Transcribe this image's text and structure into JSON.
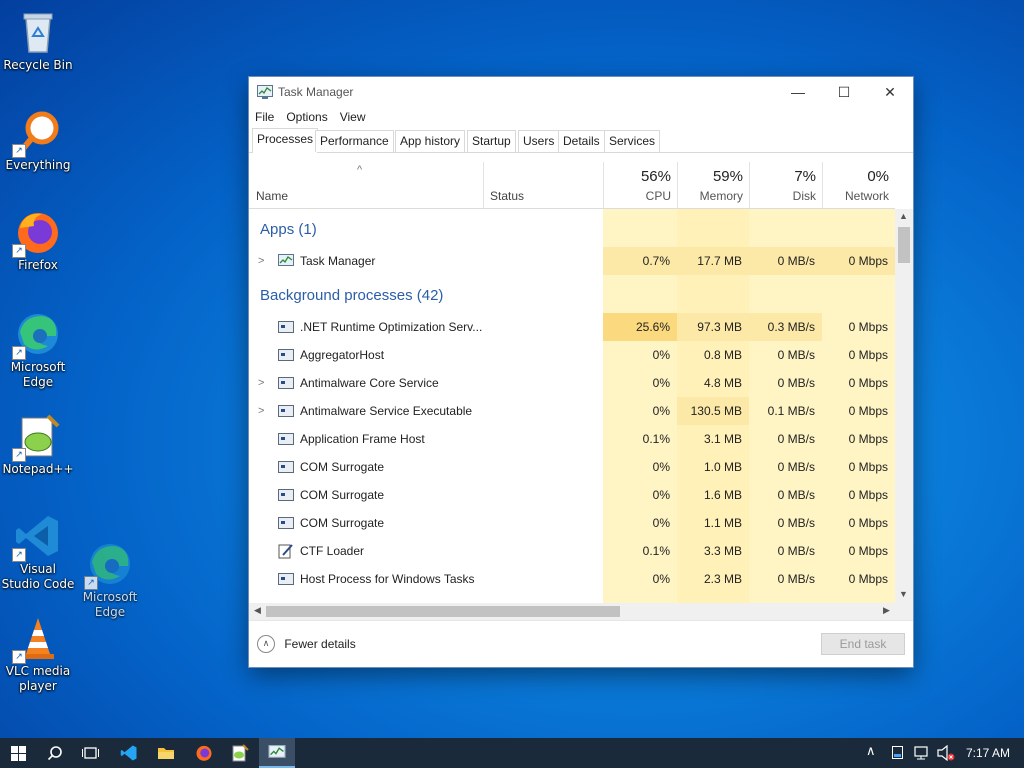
{
  "desktop": {
    "icons": [
      {
        "label": "Recycle Bin"
      },
      {
        "label": "Everything"
      },
      {
        "label": "Firefox"
      },
      {
        "label": "Microsoft Edge"
      },
      {
        "label": "Notepad++"
      },
      {
        "label": "Visual Studio Code"
      },
      {
        "label": "VLC media player"
      },
      {
        "label": "Microsoft Edge"
      }
    ]
  },
  "window": {
    "title": "Task Manager",
    "menu": [
      "File",
      "Options",
      "View"
    ],
    "tabs": [
      "Processes",
      "Performance",
      "App history",
      "Startup",
      "Users",
      "Details",
      "Services"
    ],
    "active_tab": "Processes",
    "columns": {
      "name": "Name",
      "status": "Status",
      "cpu": {
        "pct": "56%",
        "label": "CPU"
      },
      "memory": {
        "pct": "59%",
        "label": "Memory"
      },
      "disk": {
        "pct": "7%",
        "label": "Disk"
      },
      "network": {
        "pct": "0%",
        "label": "Network"
      }
    },
    "apps_group": "Apps (1)",
    "apps": [
      {
        "name": "Task Manager",
        "cpu": "0.7%",
        "memory": "17.7 MB",
        "disk": "0 MB/s",
        "network": "0 Mbps"
      }
    ],
    "bg_group": "Background processes (42)",
    "background": [
      {
        "name": ".NET Runtime Optimization Serv...",
        "cpu": "25.6%",
        "memory": "97.3 MB",
        "disk": "0.3 MB/s",
        "network": "0 Mbps"
      },
      {
        "name": "AggregatorHost",
        "cpu": "0%",
        "memory": "0.8 MB",
        "disk": "0 MB/s",
        "network": "0 Mbps"
      },
      {
        "name": "Antimalware Core Service",
        "cpu": "0%",
        "memory": "4.8 MB",
        "disk": "0 MB/s",
        "network": "0 Mbps"
      },
      {
        "name": "Antimalware Service Executable",
        "cpu": "0%",
        "memory": "130.5 MB",
        "disk": "0.1 MB/s",
        "network": "0 Mbps"
      },
      {
        "name": "Application Frame Host",
        "cpu": "0.1%",
        "memory": "3.1 MB",
        "disk": "0 MB/s",
        "network": "0 Mbps"
      },
      {
        "name": "COM Surrogate",
        "cpu": "0%",
        "memory": "1.0 MB",
        "disk": "0 MB/s",
        "network": "0 Mbps"
      },
      {
        "name": "COM Surrogate",
        "cpu": "0%",
        "memory": "1.6 MB",
        "disk": "0 MB/s",
        "network": "0 Mbps"
      },
      {
        "name": "COM Surrogate",
        "cpu": "0%",
        "memory": "1.1 MB",
        "disk": "0 MB/s",
        "network": "0 Mbps"
      },
      {
        "name": "CTF Loader",
        "cpu": "0.1%",
        "memory": "3.3 MB",
        "disk": "0 MB/s",
        "network": "0 Mbps"
      },
      {
        "name": "Host Process for Windows Tasks",
        "cpu": "0%",
        "memory": "2.3 MB",
        "disk": "0 MB/s",
        "network": "0 Mbps"
      }
    ],
    "footer": {
      "fewer_details": "Fewer details",
      "end_task": "End task"
    }
  },
  "taskbar": {
    "clock": "7:17 AM"
  },
  "colors": {
    "heat_light": "#fff4c4",
    "heat_mid": "#fde9a7",
    "heat_high": "#fbd97e",
    "group_text": "#2a5ea8"
  }
}
